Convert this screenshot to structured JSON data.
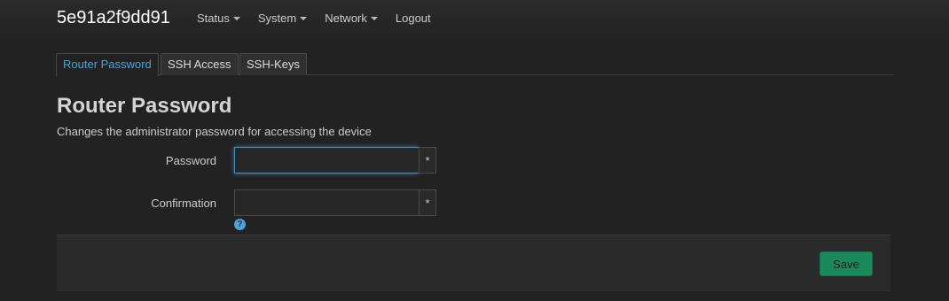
{
  "header": {
    "brand": "5e91a2f9dd91",
    "menu": [
      {
        "label": "Status",
        "dropdown": true
      },
      {
        "label": "System",
        "dropdown": true
      },
      {
        "label": "Network",
        "dropdown": true
      },
      {
        "label": "Logout",
        "dropdown": false
      }
    ]
  },
  "tabs": [
    {
      "label": "Router Password",
      "active": true
    },
    {
      "label": "SSH Access",
      "active": false
    },
    {
      "label": "SSH-Keys",
      "active": false
    }
  ],
  "page": {
    "title": "Router Password",
    "description": "Changes the administrator password for accessing the device"
  },
  "form": {
    "password_label": "Password",
    "password_value": "",
    "password_reveal": "*",
    "confirmation_label": "Confirmation",
    "confirmation_value": "",
    "confirmation_reveal": "*",
    "help_icon": "?"
  },
  "actions": {
    "save_label": "Save"
  },
  "colors": {
    "accent": "#4ba3d6",
    "save": "#1b8a5a",
    "background": "#222222"
  }
}
